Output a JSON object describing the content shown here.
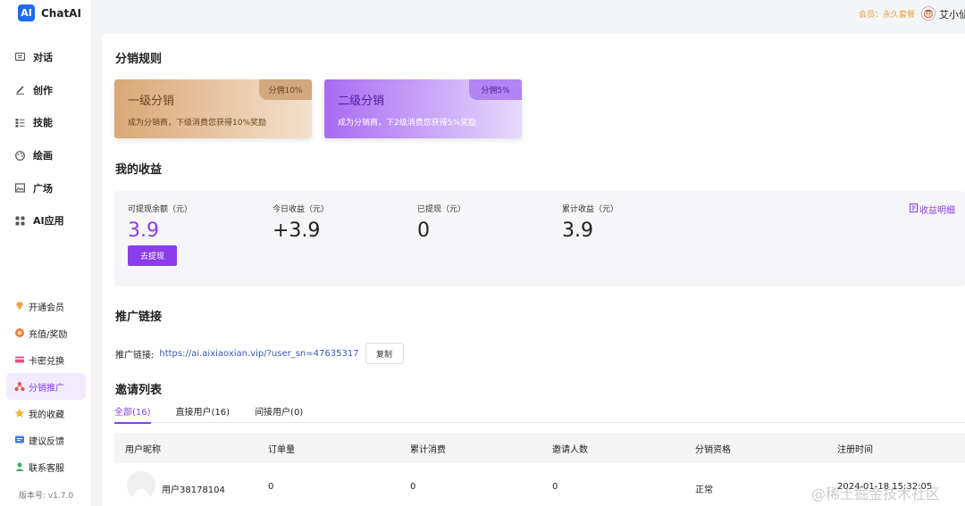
{
  "brand": {
    "logo": "AI",
    "name": "ChatAI"
  },
  "sidebar": {
    "items": [
      {
        "label": "对话",
        "icon": "chat-icon"
      },
      {
        "label": "创作",
        "icon": "pen-icon"
      },
      {
        "label": "技能",
        "icon": "list-icon"
      },
      {
        "label": "绘画",
        "icon": "palette-icon"
      },
      {
        "label": "广场",
        "icon": "image-icon"
      },
      {
        "label": "AI应用",
        "icon": "grid-icon"
      }
    ],
    "bottom_items": [
      {
        "label": "开通会员",
        "icon": "diamond-icon"
      },
      {
        "label": "充值/奖励",
        "icon": "coin-icon"
      },
      {
        "label": "卡密兑换",
        "icon": "card-icon"
      },
      {
        "label": "分销推广",
        "icon": "org-icon",
        "active": true
      },
      {
        "label": "我的收藏",
        "icon": "star-icon"
      },
      {
        "label": "建议反馈",
        "icon": "feedback-icon"
      },
      {
        "label": "联系客服",
        "icon": "service-icon"
      }
    ],
    "version": "版本号: v1.7.0"
  },
  "topbar": {
    "member": "会员：永久套餐",
    "user": "艾小仙"
  },
  "rules": {
    "title": "分销规则",
    "cards": [
      {
        "title": "一级分销",
        "badge": "分佣10%",
        "desc": "成为分销商，下级消费您获得10%奖励"
      },
      {
        "title": "二级分销",
        "badge": "分佣5%",
        "desc": "成为分销商，下2级消费您获得5%奖励"
      }
    ]
  },
  "earnings": {
    "title": "我的收益",
    "withdrawable_label": "可提现余额（元）",
    "withdrawable_value": "3.9",
    "withdraw_button": "去提现",
    "today_label": "今日收益（元）",
    "today_value": "+3.9",
    "withdrawn_label": "已提现（元）",
    "withdrawn_value": "0",
    "total_label": "累计收益（元）",
    "total_value": "3.9",
    "detail_link": "收益明细"
  },
  "promo": {
    "title": "推广链接",
    "label": "推广链接:",
    "url": "https://ai.aixiaoxian.vip/?user_sn=47635317",
    "copy_button": "复制"
  },
  "invites": {
    "title": "邀请列表",
    "tabs": [
      "全部(16)",
      "直接用户(16)",
      "间接用户(0)"
    ],
    "columns": [
      "用户昵称",
      "订单量",
      "累计消费",
      "邀请人数",
      "分销资格",
      "注册时间"
    ],
    "rows": [
      {
        "name": "用户38178104",
        "orders": "0",
        "spend": "0",
        "invited": "0",
        "status": "正常",
        "registered": "2024-01-18 15:32:05"
      }
    ]
  },
  "watermark": "@稀土掘金技术社区",
  "colors": {
    "accent": "#8b3dea",
    "brand": "#1e6cf0",
    "member": "#e4a23b"
  }
}
